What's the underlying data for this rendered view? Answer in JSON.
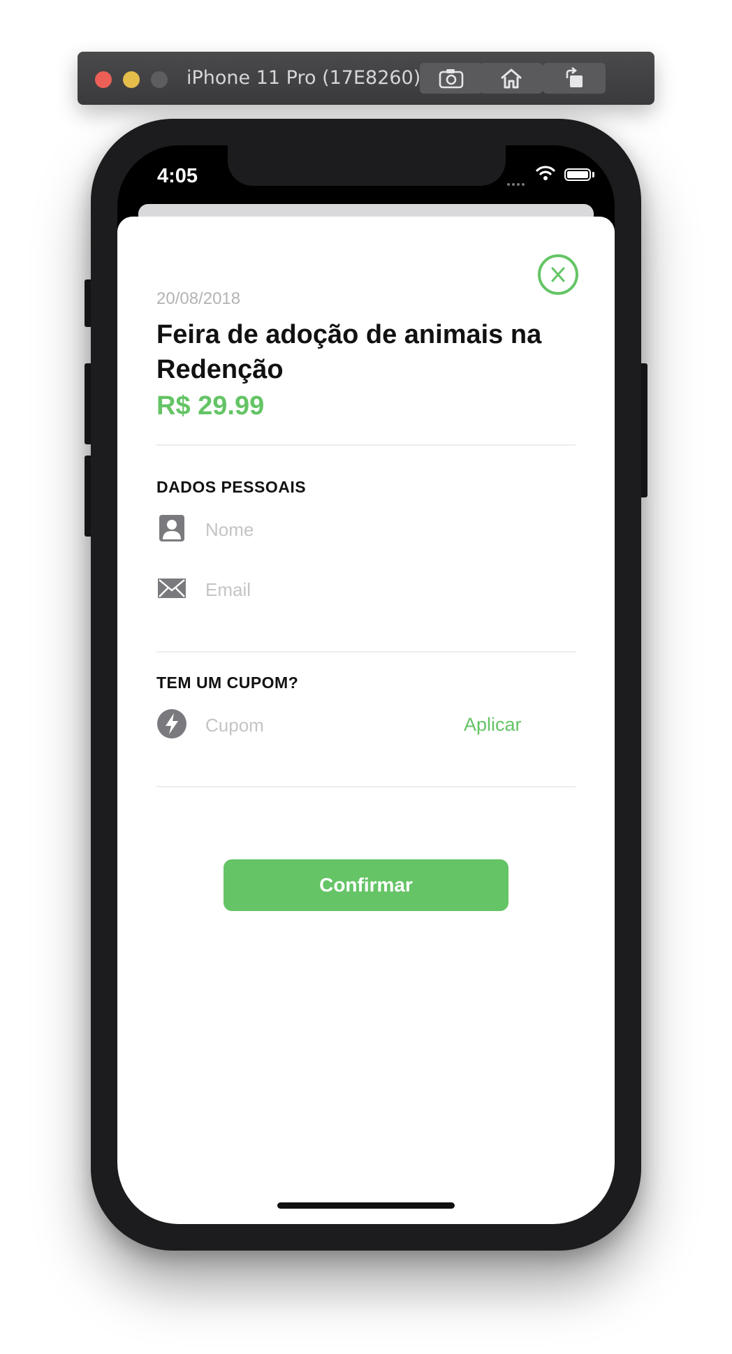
{
  "simulator": {
    "title": "iPhone 11 Pro (17E8260)",
    "buttons": [
      "screenshot-icon",
      "home-icon",
      "rotate-icon"
    ]
  },
  "status_bar": {
    "time": "4:05"
  },
  "event": {
    "date": "20/08/2018",
    "title": "Feira de adoção de animais na Redenção",
    "price": "R$ 29.99"
  },
  "personal": {
    "label": "DADOS PESSOAIS",
    "name_placeholder": "Nome",
    "email_placeholder": "Email"
  },
  "coupon": {
    "label": "TEM UM CUPOM?",
    "placeholder": "Cupom",
    "apply_label": "Aplicar"
  },
  "confirm_label": "Confirmar",
  "colors": {
    "accent": "#65c466",
    "muted": "#b3b3b3",
    "icon": "#7a7a7e"
  }
}
